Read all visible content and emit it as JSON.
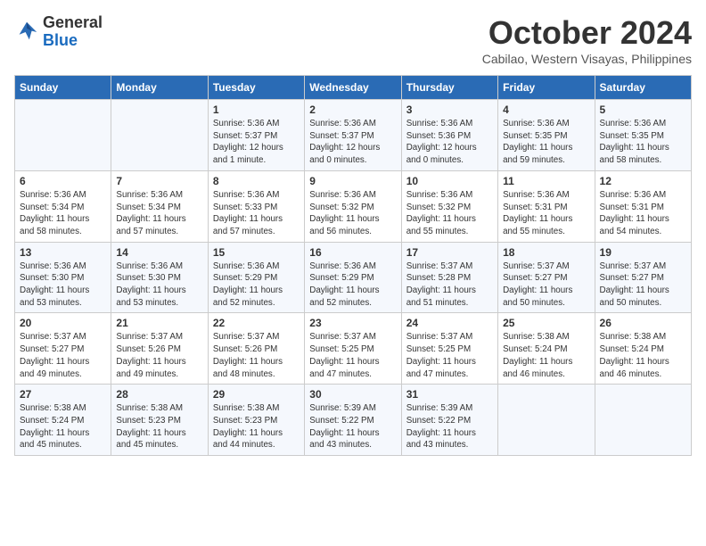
{
  "header": {
    "logo_line1": "General",
    "logo_line2": "Blue",
    "month": "October 2024",
    "location": "Cabilao, Western Visayas, Philippines"
  },
  "days_of_week": [
    "Sunday",
    "Monday",
    "Tuesday",
    "Wednesday",
    "Thursday",
    "Friday",
    "Saturday"
  ],
  "weeks": [
    [
      {
        "day": "",
        "info": ""
      },
      {
        "day": "",
        "info": ""
      },
      {
        "day": "1",
        "info": "Sunrise: 5:36 AM\nSunset: 5:37 PM\nDaylight: 12 hours\nand 1 minute."
      },
      {
        "day": "2",
        "info": "Sunrise: 5:36 AM\nSunset: 5:37 PM\nDaylight: 12 hours\nand 0 minutes."
      },
      {
        "day": "3",
        "info": "Sunrise: 5:36 AM\nSunset: 5:36 PM\nDaylight: 12 hours\nand 0 minutes."
      },
      {
        "day": "4",
        "info": "Sunrise: 5:36 AM\nSunset: 5:35 PM\nDaylight: 11 hours\nand 59 minutes."
      },
      {
        "day": "5",
        "info": "Sunrise: 5:36 AM\nSunset: 5:35 PM\nDaylight: 11 hours\nand 58 minutes."
      }
    ],
    [
      {
        "day": "6",
        "info": "Sunrise: 5:36 AM\nSunset: 5:34 PM\nDaylight: 11 hours\nand 58 minutes."
      },
      {
        "day": "7",
        "info": "Sunrise: 5:36 AM\nSunset: 5:34 PM\nDaylight: 11 hours\nand 57 minutes."
      },
      {
        "day": "8",
        "info": "Sunrise: 5:36 AM\nSunset: 5:33 PM\nDaylight: 11 hours\nand 57 minutes."
      },
      {
        "day": "9",
        "info": "Sunrise: 5:36 AM\nSunset: 5:32 PM\nDaylight: 11 hours\nand 56 minutes."
      },
      {
        "day": "10",
        "info": "Sunrise: 5:36 AM\nSunset: 5:32 PM\nDaylight: 11 hours\nand 55 minutes."
      },
      {
        "day": "11",
        "info": "Sunrise: 5:36 AM\nSunset: 5:31 PM\nDaylight: 11 hours\nand 55 minutes."
      },
      {
        "day": "12",
        "info": "Sunrise: 5:36 AM\nSunset: 5:31 PM\nDaylight: 11 hours\nand 54 minutes."
      }
    ],
    [
      {
        "day": "13",
        "info": "Sunrise: 5:36 AM\nSunset: 5:30 PM\nDaylight: 11 hours\nand 53 minutes."
      },
      {
        "day": "14",
        "info": "Sunrise: 5:36 AM\nSunset: 5:30 PM\nDaylight: 11 hours\nand 53 minutes."
      },
      {
        "day": "15",
        "info": "Sunrise: 5:36 AM\nSunset: 5:29 PM\nDaylight: 11 hours\nand 52 minutes."
      },
      {
        "day": "16",
        "info": "Sunrise: 5:36 AM\nSunset: 5:29 PM\nDaylight: 11 hours\nand 52 minutes."
      },
      {
        "day": "17",
        "info": "Sunrise: 5:37 AM\nSunset: 5:28 PM\nDaylight: 11 hours\nand 51 minutes."
      },
      {
        "day": "18",
        "info": "Sunrise: 5:37 AM\nSunset: 5:27 PM\nDaylight: 11 hours\nand 50 minutes."
      },
      {
        "day": "19",
        "info": "Sunrise: 5:37 AM\nSunset: 5:27 PM\nDaylight: 11 hours\nand 50 minutes."
      }
    ],
    [
      {
        "day": "20",
        "info": "Sunrise: 5:37 AM\nSunset: 5:27 PM\nDaylight: 11 hours\nand 49 minutes."
      },
      {
        "day": "21",
        "info": "Sunrise: 5:37 AM\nSunset: 5:26 PM\nDaylight: 11 hours\nand 49 minutes."
      },
      {
        "day": "22",
        "info": "Sunrise: 5:37 AM\nSunset: 5:26 PM\nDaylight: 11 hours\nand 48 minutes."
      },
      {
        "day": "23",
        "info": "Sunrise: 5:37 AM\nSunset: 5:25 PM\nDaylight: 11 hours\nand 47 minutes."
      },
      {
        "day": "24",
        "info": "Sunrise: 5:37 AM\nSunset: 5:25 PM\nDaylight: 11 hours\nand 47 minutes."
      },
      {
        "day": "25",
        "info": "Sunrise: 5:38 AM\nSunset: 5:24 PM\nDaylight: 11 hours\nand 46 minutes."
      },
      {
        "day": "26",
        "info": "Sunrise: 5:38 AM\nSunset: 5:24 PM\nDaylight: 11 hours\nand 46 minutes."
      }
    ],
    [
      {
        "day": "27",
        "info": "Sunrise: 5:38 AM\nSunset: 5:24 PM\nDaylight: 11 hours\nand 45 minutes."
      },
      {
        "day": "28",
        "info": "Sunrise: 5:38 AM\nSunset: 5:23 PM\nDaylight: 11 hours\nand 45 minutes."
      },
      {
        "day": "29",
        "info": "Sunrise: 5:38 AM\nSunset: 5:23 PM\nDaylight: 11 hours\nand 44 minutes."
      },
      {
        "day": "30",
        "info": "Sunrise: 5:39 AM\nSunset: 5:22 PM\nDaylight: 11 hours\nand 43 minutes."
      },
      {
        "day": "31",
        "info": "Sunrise: 5:39 AM\nSunset: 5:22 PM\nDaylight: 11 hours\nand 43 minutes."
      },
      {
        "day": "",
        "info": ""
      },
      {
        "day": "",
        "info": ""
      }
    ]
  ]
}
